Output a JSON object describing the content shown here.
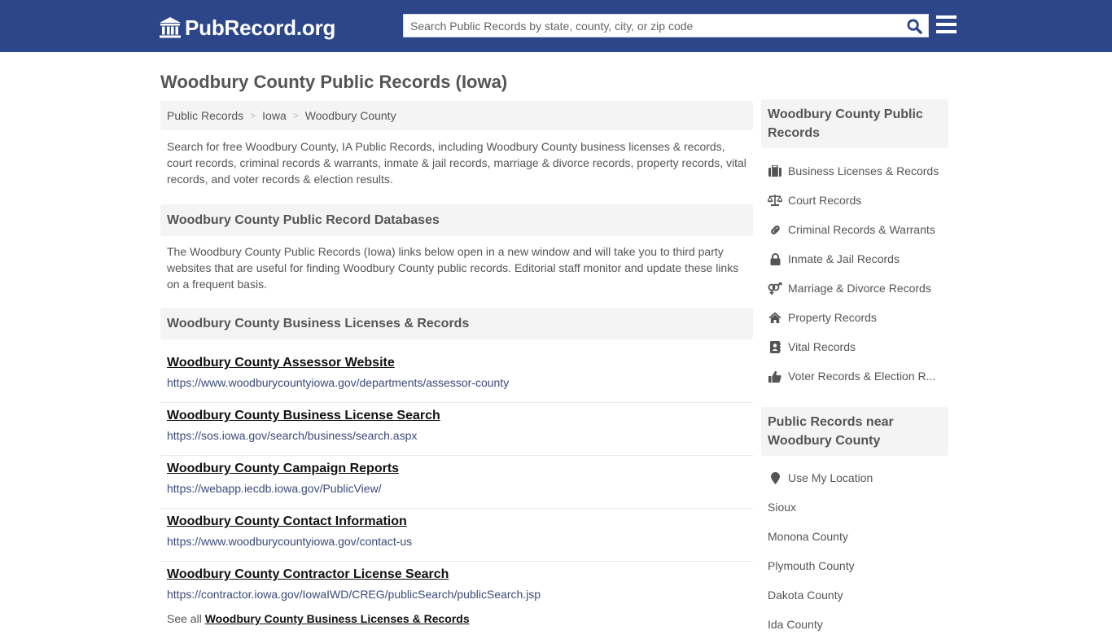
{
  "header": {
    "logo_text": "PubRecord.org",
    "search_placeholder": "Search Public Records by state, county, city, or zip code",
    "search_value": ""
  },
  "page": {
    "title": "Woodbury County Public Records (Iowa)"
  },
  "breadcrumb": [
    {
      "label": "Public Records"
    },
    {
      "label": "Iowa"
    },
    {
      "label": "Woodbury County"
    }
  ],
  "intro": "Search for free Woodbury County, IA Public Records, including Woodbury County business licenses & records, court records, criminal records & warrants, inmate & jail records, marriage & divorce records, property records, vital records, and voter records & election results.",
  "databases": {
    "heading": "Woodbury County Public Record Databases",
    "description": "The Woodbury County Public Records (Iowa) links below open in a new window and will take you to third party websites that are useful for finding Woodbury County public records. Editorial staff monitor and update these links on a frequent basis."
  },
  "business_section": {
    "heading": "Woodbury County Business Licenses & Records",
    "links": [
      {
        "title": "Woodbury County Assessor Website",
        "url": "https://www.woodburycountyiowa.gov/departments/assessor-county"
      },
      {
        "title": "Woodbury County Business License Search",
        "url": "https://sos.iowa.gov/search/business/search.aspx"
      },
      {
        "title": "Woodbury County Campaign Reports",
        "url": "https://webapp.iecdb.iowa.gov/PublicView/"
      },
      {
        "title": "Woodbury County Contact Information",
        "url": "https://www.woodburycountyiowa.gov/contact-us"
      },
      {
        "title": "Woodbury County Contractor License Search",
        "url": "https://contractor.iowa.gov/IowaIWD/CREG/publicSearch/publicSearch.jsp"
      }
    ],
    "see_all_prefix": "See all",
    "see_all_link": "Woodbury County Business Licenses & Records"
  },
  "sidebar": {
    "records_heading": "Woodbury County Public Records",
    "records_items": [
      {
        "label": "Business Licenses & Records",
        "icon": "briefcase-icon"
      },
      {
        "label": "Court Records",
        "icon": "balance-scale-icon"
      },
      {
        "label": "Criminal Records & Warrants",
        "icon": "link-icon"
      },
      {
        "label": "Inmate & Jail Records",
        "icon": "lock-icon"
      },
      {
        "label": "Marriage & Divorce Records",
        "icon": "venus-mars-icon"
      },
      {
        "label": "Property Records",
        "icon": "home-icon"
      },
      {
        "label": "Vital Records",
        "icon": "address-book-icon"
      },
      {
        "label": "Voter Records & Election R...",
        "icon": "thumbs-up-icon"
      }
    ],
    "nearby_heading": "Public Records near Woodbury County",
    "location_label": "Use My Location",
    "nearby_items": [
      {
        "label": "Sioux"
      },
      {
        "label": "Monona County"
      },
      {
        "label": "Plymouth County"
      },
      {
        "label": "Dakota County"
      },
      {
        "label": "Ida County"
      }
    ]
  },
  "colors": {
    "header_bg": "#2d4689",
    "panel_bg": "#f4f4f4",
    "text": "#555555",
    "link_title": "#111111",
    "link_url": "#3a4a7a",
    "search_icon": "#2d4689"
  }
}
